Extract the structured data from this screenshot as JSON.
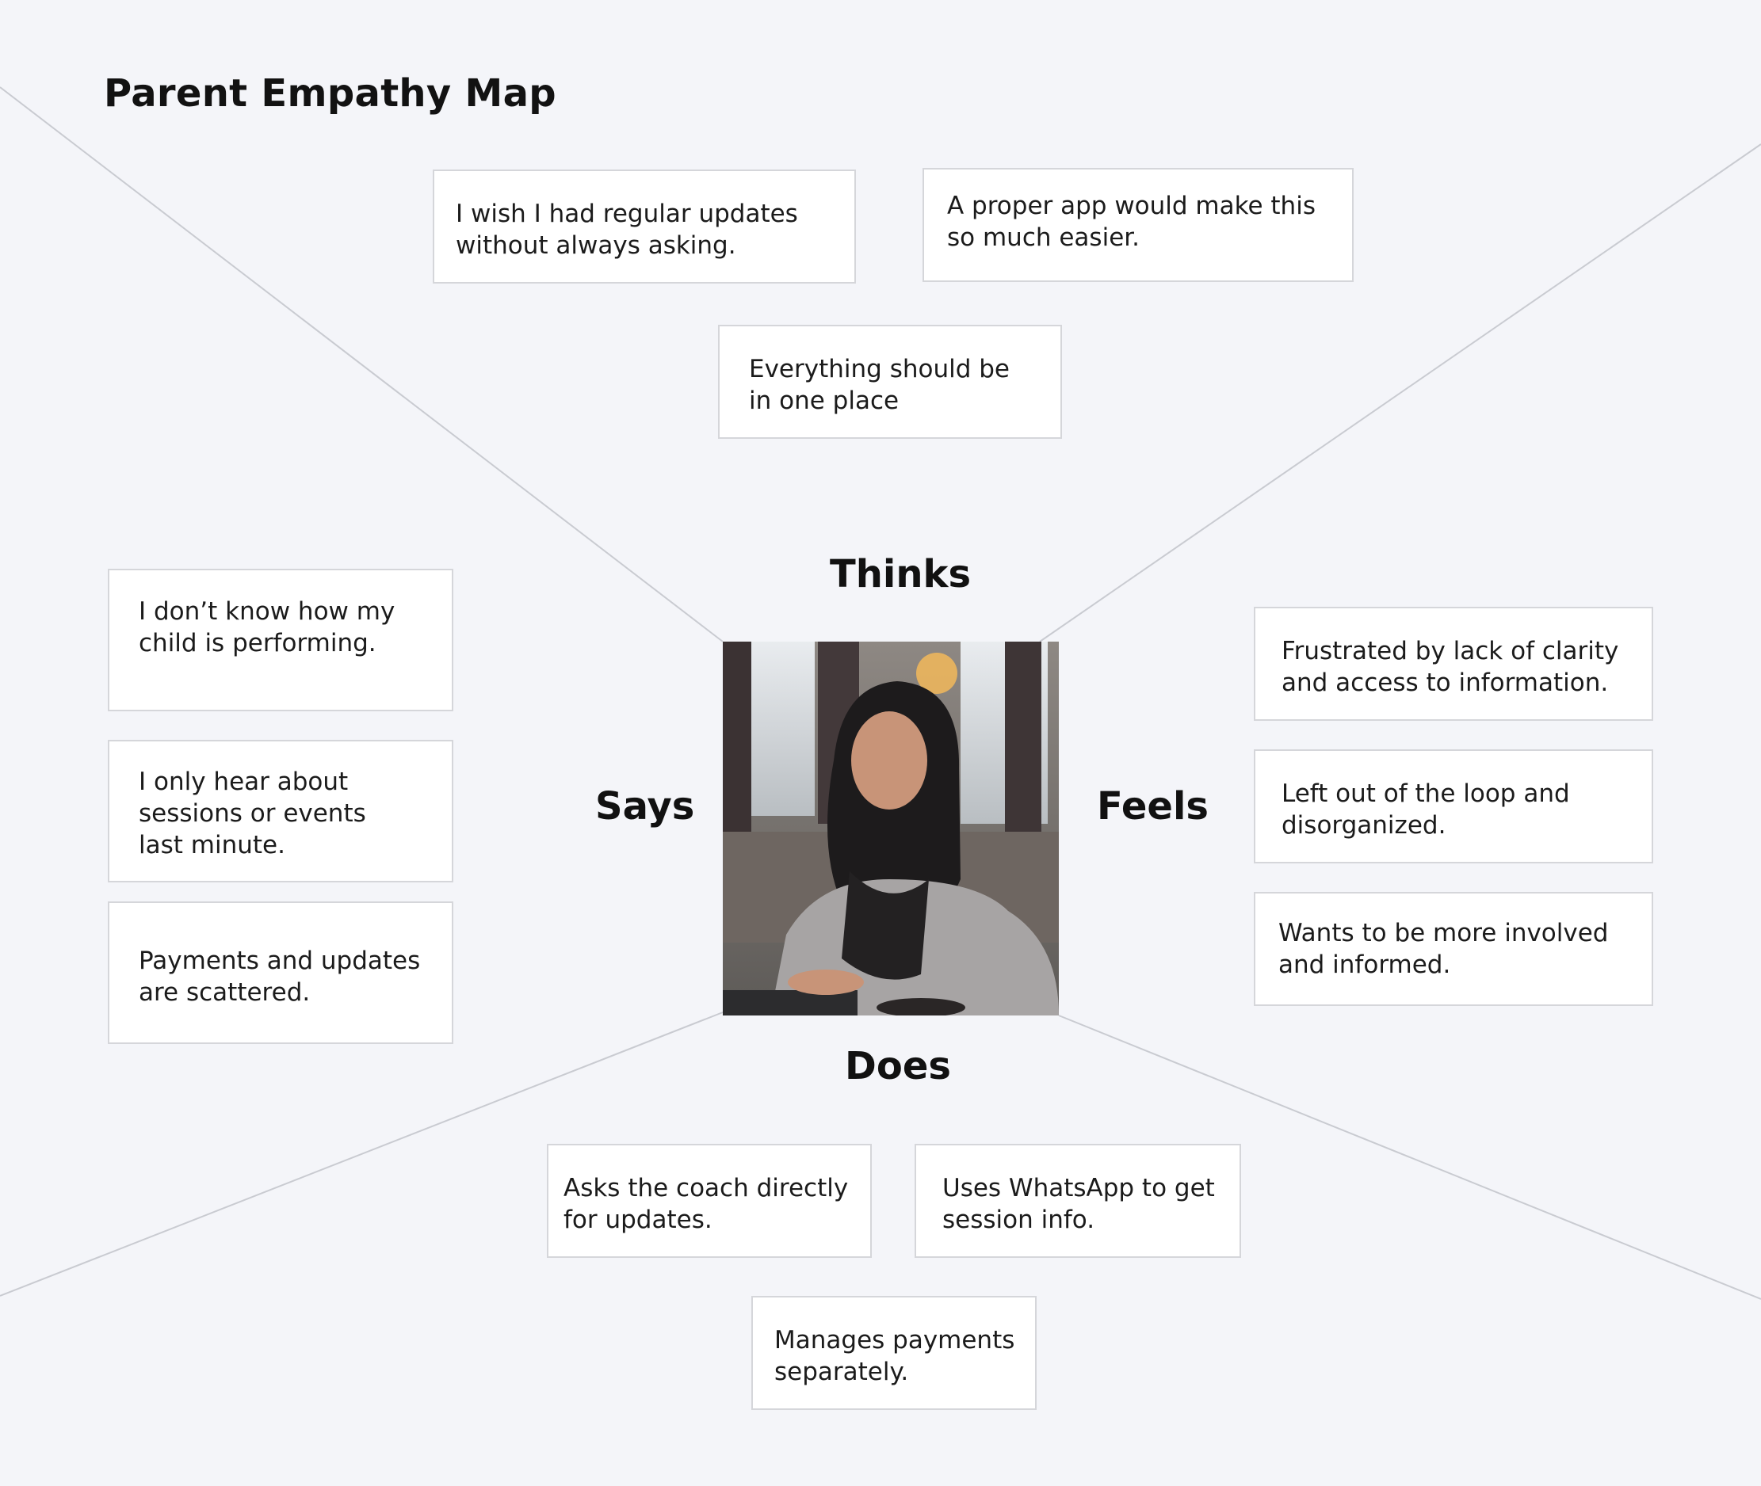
{
  "title": "Parent Empathy Map",
  "colors": {
    "background": "#f4f5f9",
    "card_background": "#ffffff",
    "card_border": "#d5d6da",
    "divider_lines": "#c9cbd1",
    "text": "#151515"
  },
  "quadrants": {
    "thinks": {
      "label": "Thinks",
      "notes": [
        "I wish I had regular updates\nwithout always asking.",
        "A proper app would make this\nso much easier.",
        "Everything should be\nin one place"
      ]
    },
    "says": {
      "label": "Says",
      "notes": [
        "I don’t know how my\nchild is performing.",
        "I only hear about\nsessions or events\nlast minute.",
        "Payments and updates\nare scattered."
      ]
    },
    "feels": {
      "label": "Feels",
      "notes": [
        "Frustrated by lack of clarity\nand access to information.",
        "Left out of the loop and\ndisorganized.",
        "Wants to be more involved\nand informed."
      ]
    },
    "does": {
      "label": "Does",
      "notes": [
        "Asks the coach directly\nfor updates.",
        "Uses WhatsApp to get\nsession info.",
        "Manages payments\nseparately."
      ]
    }
  },
  "persona_image": "woman-in-hijab-using-laptop-photo"
}
